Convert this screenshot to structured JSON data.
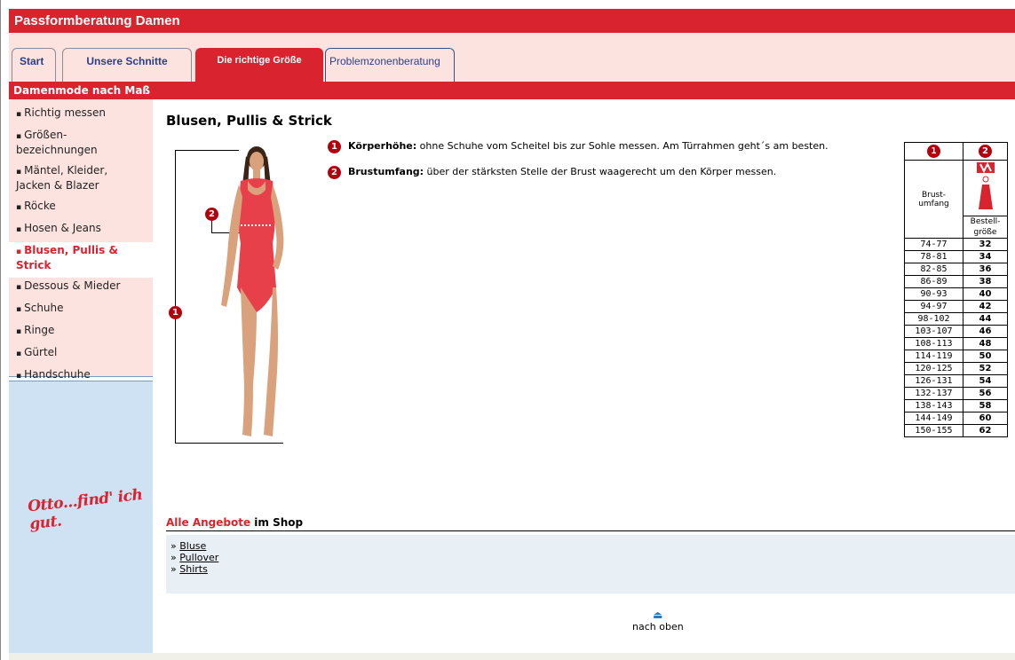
{
  "app_title": "Passformberatung Damen",
  "tabs": [
    {
      "label": "Start"
    },
    {
      "label": "Unsere Schnitte"
    },
    {
      "label": "Die richtige Größe"
    },
    {
      "label": "Problemzonenberatung"
    }
  ],
  "section_title": "Damenmode nach Maß",
  "sidebar": {
    "items": [
      {
        "label": "Richtig messen"
      },
      {
        "label": "Größen-bezeichnungen"
      },
      {
        "label": "Mäntel, Kleider, Jacken & Blazer"
      },
      {
        "label": "Röcke"
      },
      {
        "label": "Hosen & Jeans"
      },
      {
        "label": "Blusen, Pullis & Strick"
      },
      {
        "label": "Dessous & Mieder"
      },
      {
        "label": "Schuhe"
      },
      {
        "label": "Ringe"
      },
      {
        "label": "Gürtel"
      },
      {
        "label": "Handschuhe"
      }
    ],
    "active_index": 5,
    "logo_text": "Otto...find' ich gut."
  },
  "main": {
    "title": "Blusen, Pullis & Strick",
    "descriptions": [
      {
        "num": "1",
        "bold": "Körperhöhe:",
        "text": " ohne Schuhe vom Scheitel bis zur Sohle messen. Am Türrahmen geht´s am besten."
      },
      {
        "num": "2",
        "bold": "Brustumfang:",
        "text": " über der stärksten Stelle der Brust waagerecht um den Körper messen."
      }
    ],
    "figure_markers": [
      "1",
      "2"
    ],
    "size_table": {
      "header": [
        "1",
        "2"
      ],
      "col1_label": "Brust-umfang",
      "col2_label": "Bestell-größe",
      "rows": [
        {
          "brust": "74-77",
          "groesse": "32"
        },
        {
          "brust": "78-81",
          "groesse": "34"
        },
        {
          "brust": "82-85",
          "groesse": "36"
        },
        {
          "brust": "86-89",
          "groesse": "38"
        },
        {
          "brust": "90-93",
          "groesse": "40"
        },
        {
          "brust": "94-97",
          "groesse": "42"
        },
        {
          "brust": "98-102",
          "groesse": "44"
        },
        {
          "brust": "103-107",
          "groesse": "46"
        },
        {
          "brust": "108-113",
          "groesse": "48"
        },
        {
          "brust": "114-119",
          "groesse": "50"
        },
        {
          "brust": "120-125",
          "groesse": "52"
        },
        {
          "brust": "126-131",
          "groesse": "54"
        },
        {
          "brust": "132-137",
          "groesse": "56"
        },
        {
          "brust": "138-143",
          "groesse": "58"
        },
        {
          "brust": "144-149",
          "groesse": "60"
        },
        {
          "brust": "150-155",
          "groesse": "62"
        }
      ]
    },
    "shop": {
      "head_red": "Alle Angebote",
      "head_rest": " im Shop",
      "links": [
        "Bluse",
        "Pullover",
        "Shirts"
      ],
      "link_prefix": "» "
    },
    "to_top": "nach oben"
  },
  "colors": {
    "brand_red": "#d9232e",
    "tab_bg": "#fde3df",
    "sidebar_blue": "#cfe2f3",
    "swimsuit": "#e8404a"
  }
}
